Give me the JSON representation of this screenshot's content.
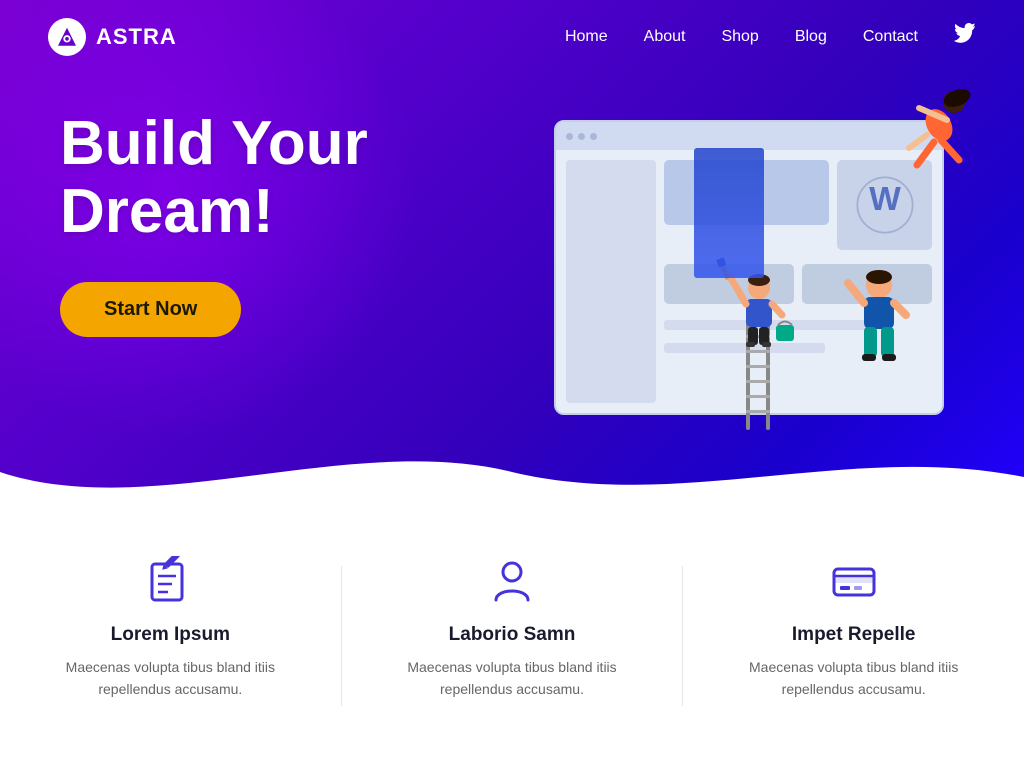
{
  "header": {
    "logo_text": "ASTRA",
    "nav": {
      "home": "Home",
      "about": "About",
      "shop": "Shop",
      "blog": "Blog",
      "contact": "Contact"
    }
  },
  "hero": {
    "title_line1": "Build Your",
    "title_line2": "Dream!",
    "cta_label": "Start Now"
  },
  "features": [
    {
      "icon": "edit-icon",
      "title": "Lorem Ipsum",
      "desc": "Maecenas volupta tibus bland itiis repellendus accusamu."
    },
    {
      "icon": "user-icon",
      "title": "Laborio Samn",
      "desc": "Maecenas volupta tibus bland itiis repellendus accusamu."
    },
    {
      "icon": "card-icon",
      "title": "Impet Repelle",
      "desc": "Maecenas volupta tibus bland itiis repellendus accusamu."
    }
  ],
  "colors": {
    "hero_start": "#8b00e8",
    "hero_end": "#2200ff",
    "cta_bg": "#f5a500",
    "accent": "#4433dd"
  }
}
